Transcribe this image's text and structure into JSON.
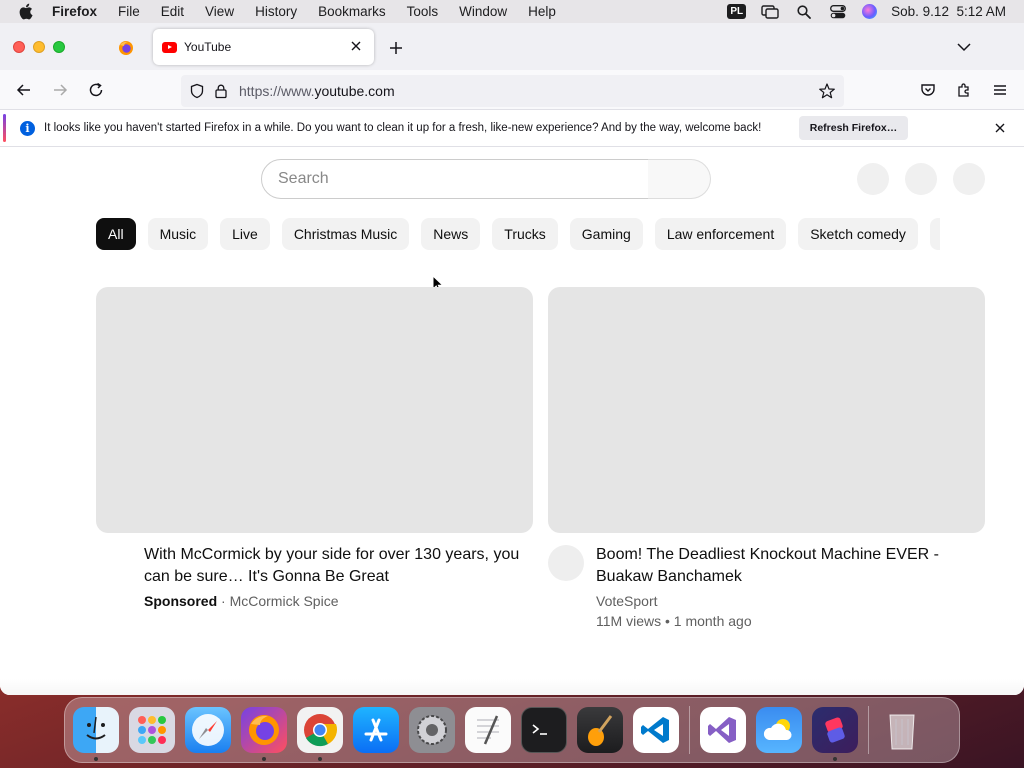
{
  "menubar": {
    "app": "Firefox",
    "items": [
      "File",
      "Edit",
      "View",
      "History",
      "Bookmarks",
      "Tools",
      "Window",
      "Help"
    ],
    "input_source": "PL",
    "datetime": "Sob. 9.12  5:12 AM"
  },
  "browser": {
    "tab_title": "YouTube",
    "url_scheme": "https://www.",
    "url_host": "youtube.com",
    "notice_text": "It looks like you haven't started Firefox in a while. Do you want to clean it up for a fresh, like-new experience? And by the way, welcome back!",
    "notice_button": "Refresh Firefox…"
  },
  "youtube": {
    "search_placeholder": "Search",
    "chips": [
      {
        "label": "All",
        "active": true
      },
      {
        "label": "Music"
      },
      {
        "label": "Live"
      },
      {
        "label": "Christmas Music"
      },
      {
        "label": "News"
      },
      {
        "label": "Trucks"
      },
      {
        "label": "Gaming"
      },
      {
        "label": "Law enforcement"
      },
      {
        "label": "Sketch comedy"
      }
    ],
    "videos": [
      {
        "title": "With McCormick by your side for over 130 years, you can be sure… It's Gonna Be Great",
        "sponsored": "Sponsored",
        "channel": "McCormick Spice"
      },
      {
        "title": "Boom! The Deadliest Knockout Machine EVER - Buakaw Banchamek",
        "channel": "VoteSport",
        "stats": "11M views • 1 month ago"
      }
    ]
  },
  "dock": {
    "apps": [
      "finder-icon",
      "launchpad-icon",
      "safari-icon",
      "firefox-icon",
      "chrome-icon",
      "app-store-icon",
      "system-preferences-icon",
      "textedit-icon",
      "terminal-icon",
      "garageband-icon",
      "vscode-icon",
      "visual-studio-icon",
      "weather-icon",
      "shortcuts-icon",
      "trash-icon"
    ]
  },
  "colors": {
    "youtube_red": "#ff0000",
    "firefox_blue": "#0060df",
    "chip_active": "#0f0f0f"
  }
}
